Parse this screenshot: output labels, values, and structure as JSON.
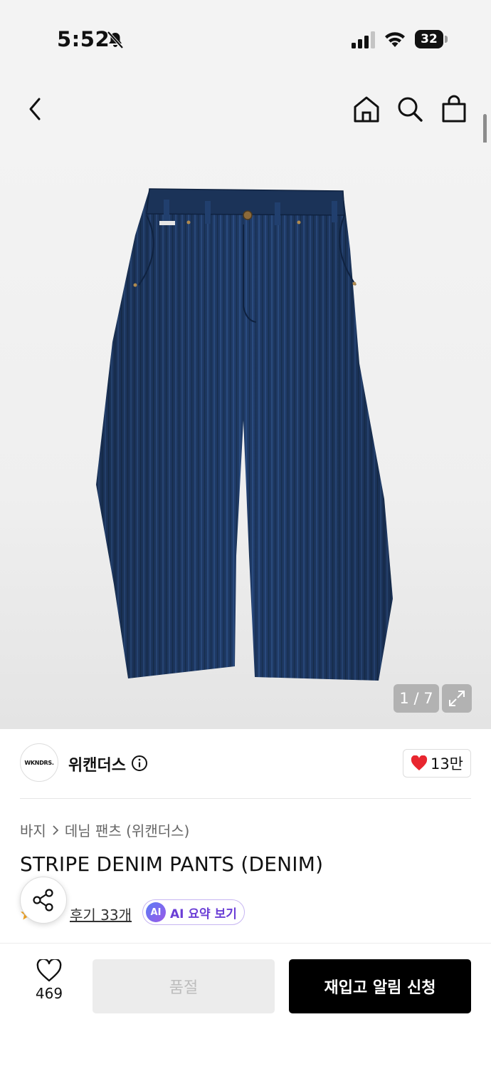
{
  "status": {
    "time": "5:52",
    "battery": "32"
  },
  "icons": {
    "back": "chevron-left-icon",
    "home": "home-icon",
    "search": "search-icon",
    "bag": "shopping-bag-icon",
    "expand": "expand-icon",
    "share": "share-icon"
  },
  "gallery": {
    "page_indicator": "1 / 7"
  },
  "brand": {
    "logo_text": "WKNDRS.",
    "name": "위캔더스",
    "likes": "13만"
  },
  "breadcrumb": {
    "category": "바지",
    "sub_category": "데님 팬츠 (위캔더스)"
  },
  "product": {
    "title": "STRIPE DENIM PANTS (DENIM)",
    "reviews_label": "후기 33개",
    "ai_icon": "AI",
    "ai_summary_label": "AI 요약 보기"
  },
  "bottom_bar": {
    "wish_count": "469",
    "soldout_label": "품절",
    "restock_label": "재입고 알림 신청"
  },
  "colors": {
    "accent": "#000000",
    "heart": "#e8262f",
    "ai": "#6b3fd6",
    "denim": "#1f3a66"
  }
}
